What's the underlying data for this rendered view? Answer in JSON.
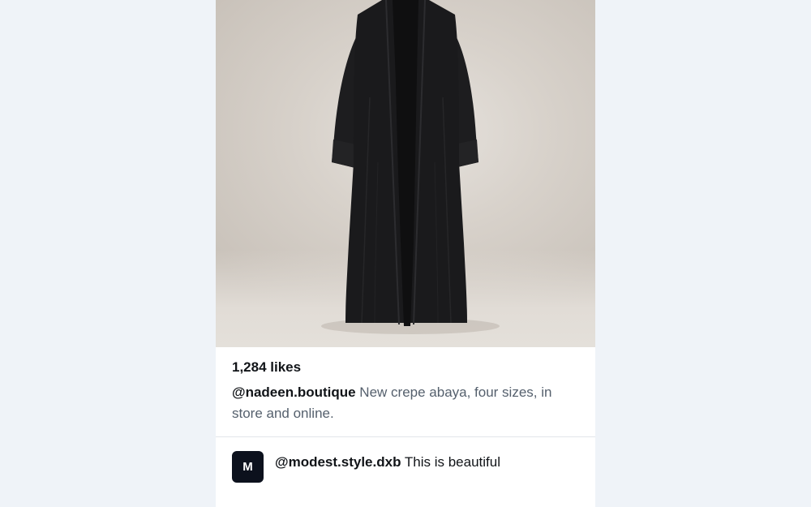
{
  "post": {
    "image": {
      "subject": "black open-front crepe abaya on mannequin"
    },
    "likes": "1,284 likes",
    "caption": {
      "author": "@nadeen.boutique",
      "text": " New crepe abaya, four sizes, in store and online."
    }
  },
  "comments": [
    {
      "avatar_initial": "M",
      "author": "@modest.style.dxb",
      "text": " This is beautiful"
    }
  ],
  "colors": {
    "page_background": "#eff3f8",
    "card_background": "#ffffff",
    "avatar_background": "#0c111d",
    "primary_text": "#111418",
    "secondary_text": "#55606d"
  }
}
